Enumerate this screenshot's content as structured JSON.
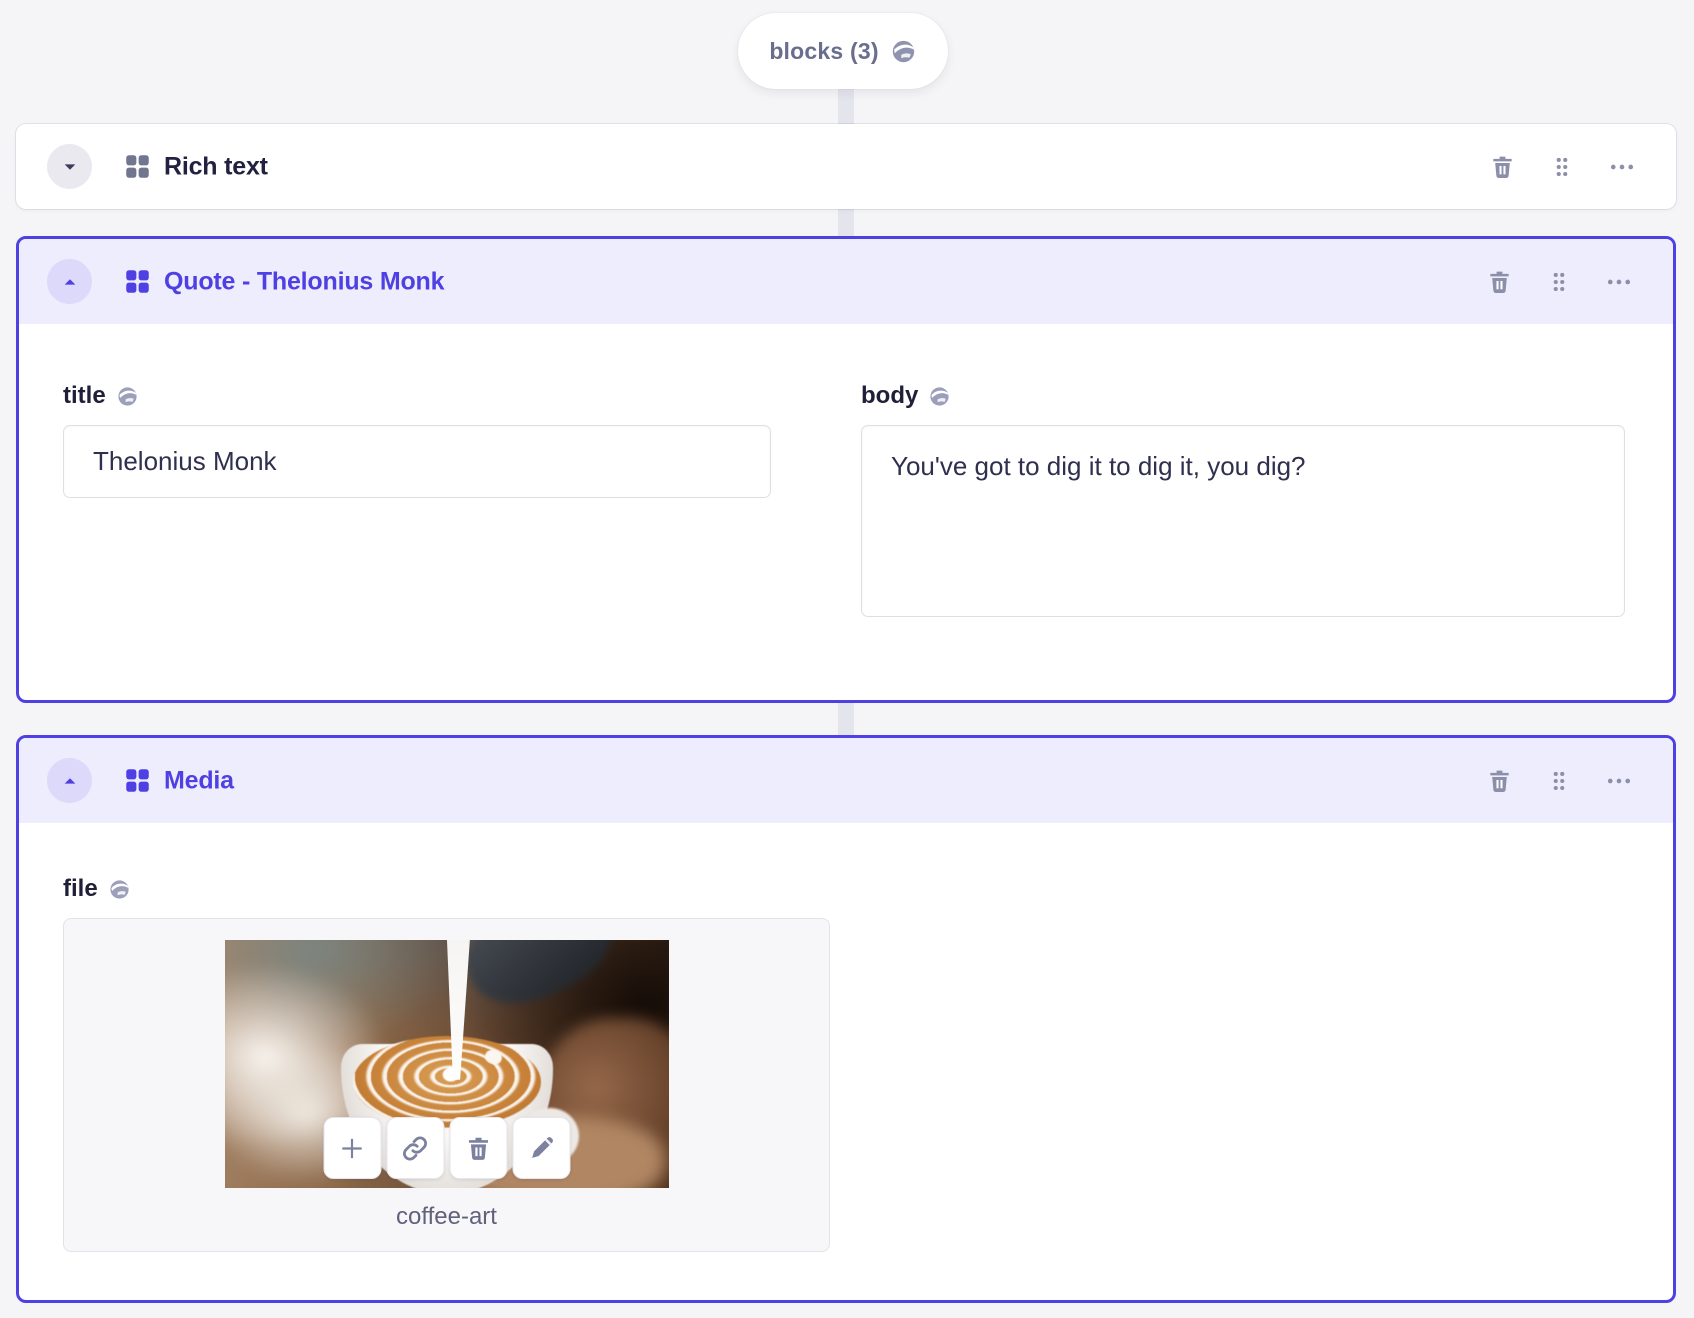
{
  "pill": {
    "label": "blocks (3)",
    "icon": "globe-icon"
  },
  "blocks": [
    {
      "title": "Rich text",
      "state": "collapsed",
      "actions": [
        "delete",
        "drag",
        "more"
      ]
    },
    {
      "title": "Quote - Thelonius Monk",
      "state": "expanded",
      "actions": [
        "delete",
        "drag",
        "more"
      ],
      "fields": {
        "title": {
          "label": "title",
          "value": "Thelonius Monk",
          "localized_icon": "globe-icon"
        },
        "body": {
          "label": "body",
          "value": "You've got to dig it to dig it, you dig?",
          "localized_icon": "globe-icon"
        }
      }
    },
    {
      "title": "Media",
      "state": "expanded",
      "actions": [
        "delete",
        "drag",
        "more"
      ],
      "fields": {
        "file": {
          "label": "file",
          "localized_icon": "globe-icon",
          "filename": "coffee-art",
          "preview": "latte-art-photo",
          "file_actions": [
            "add",
            "link",
            "delete",
            "edit"
          ]
        }
      }
    }
  ],
  "colors": {
    "page_bg": "#f5f5f7",
    "accent": "#4f40e4",
    "selected_header_bg": "#eeedfd",
    "icon_slate": "#8b8fa9",
    "text_dark": "#222240",
    "text_slate": "#6a6e8e"
  },
  "icons": {
    "globe-icon": "filled circle with white swoosh",
    "blocks-grid-icon": "2x2 rounded squares",
    "chevron-down-icon": "filled triangle down",
    "chevron-up-icon": "filled triangle up",
    "trash-icon": "filled trash can",
    "drag-handle-icon": "6 dots 2x3",
    "ellipsis-icon": "3 dots horizontal",
    "plus-icon": "+",
    "link-icon": "chain link",
    "pencil-icon": "filled diagonal pencil"
  }
}
